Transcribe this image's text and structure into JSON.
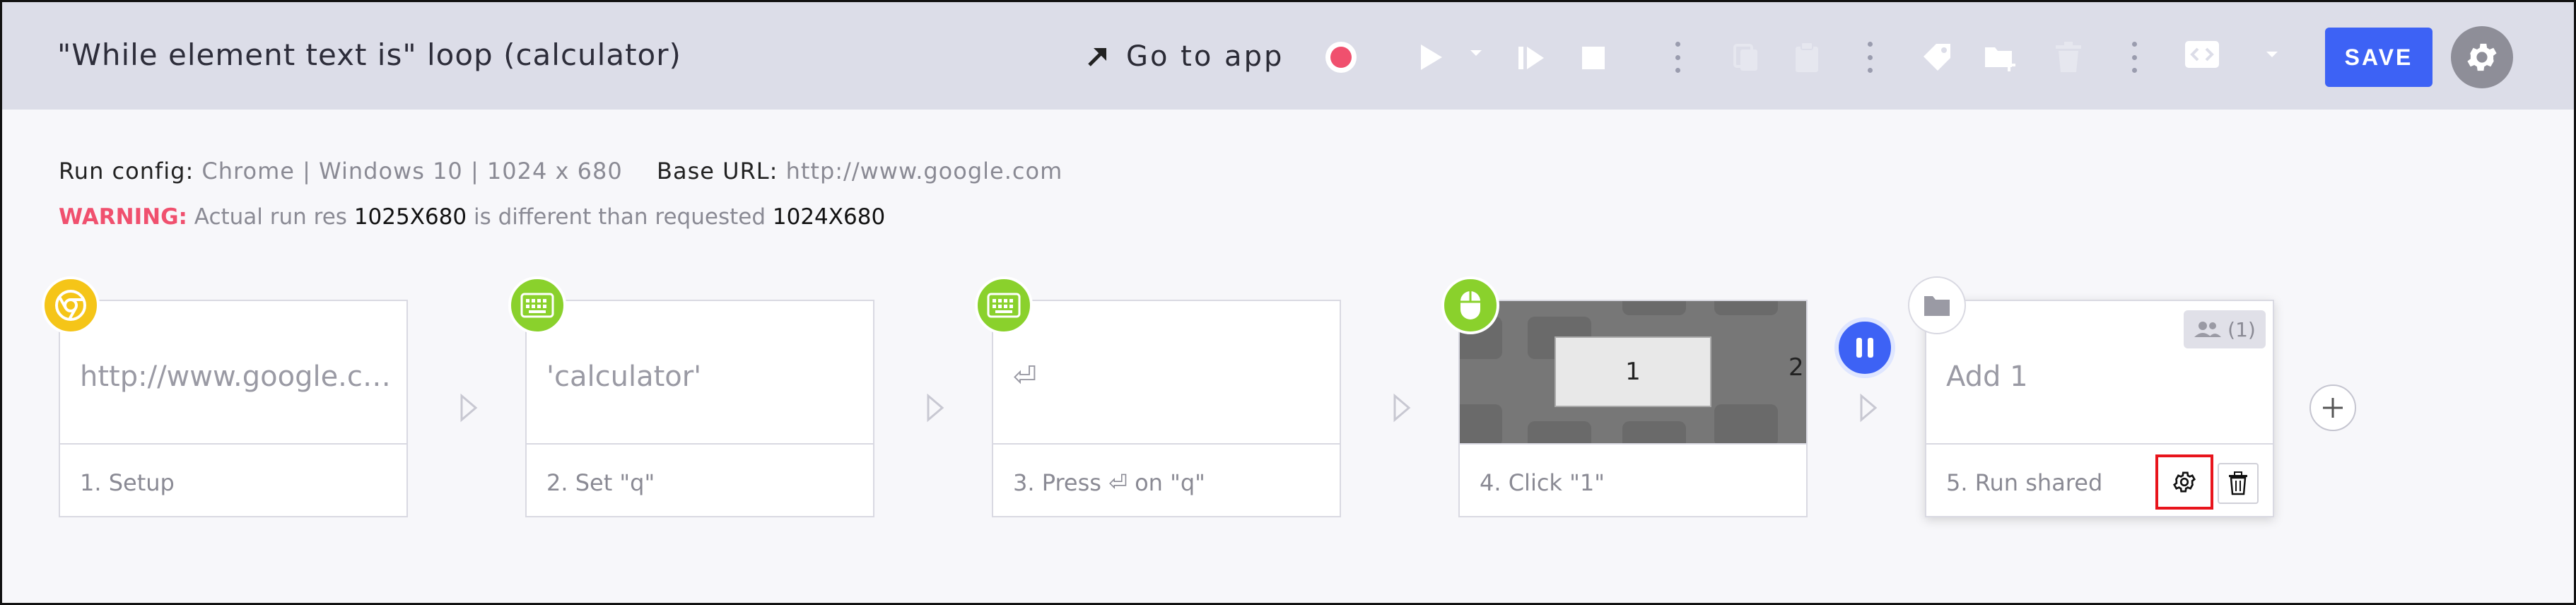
{
  "toolbar": {
    "title": "\"While element text is\" loop (calculator)",
    "goto_label": "Go to app",
    "save_label": "SAVE"
  },
  "info": {
    "run_config_label": "Run config:",
    "run_config_value": "Chrome | Windows 10 | 1024 x 680",
    "base_url_label": "Base URL:",
    "base_url_value": "http://www.google.com",
    "warning_label": "WARNING:",
    "warning_text1": "Actual run res",
    "warning_actual": "1025X680",
    "warning_text2": "is different than requested",
    "warning_requested": "1024X680"
  },
  "steps": [
    {
      "content": "http://www.google.com",
      "caption": "1. Setup",
      "icon": "chrome-icon"
    },
    {
      "content": "'calculator'",
      "caption": "2. Set \"q\"",
      "icon": "keyboard-icon"
    },
    {
      "content": "⏎",
      "caption": "3. Press ⏎ on \"q\"",
      "icon": "keyboard-icon"
    },
    {
      "thumb_one": "1",
      "thumb_two": "2",
      "caption": "4. Click \"1\"",
      "icon": "mouse-icon"
    },
    {
      "content": "Add 1",
      "caption": "5. Run shared",
      "shared_count": "(1)",
      "icon": "folder-icon"
    }
  ],
  "colors": {
    "accent": "#3d62f5",
    "warning": "#f0506e",
    "step_green": "#8ad12c",
    "setup_yellow": "#f5c518",
    "highlight": "#e8141c"
  }
}
